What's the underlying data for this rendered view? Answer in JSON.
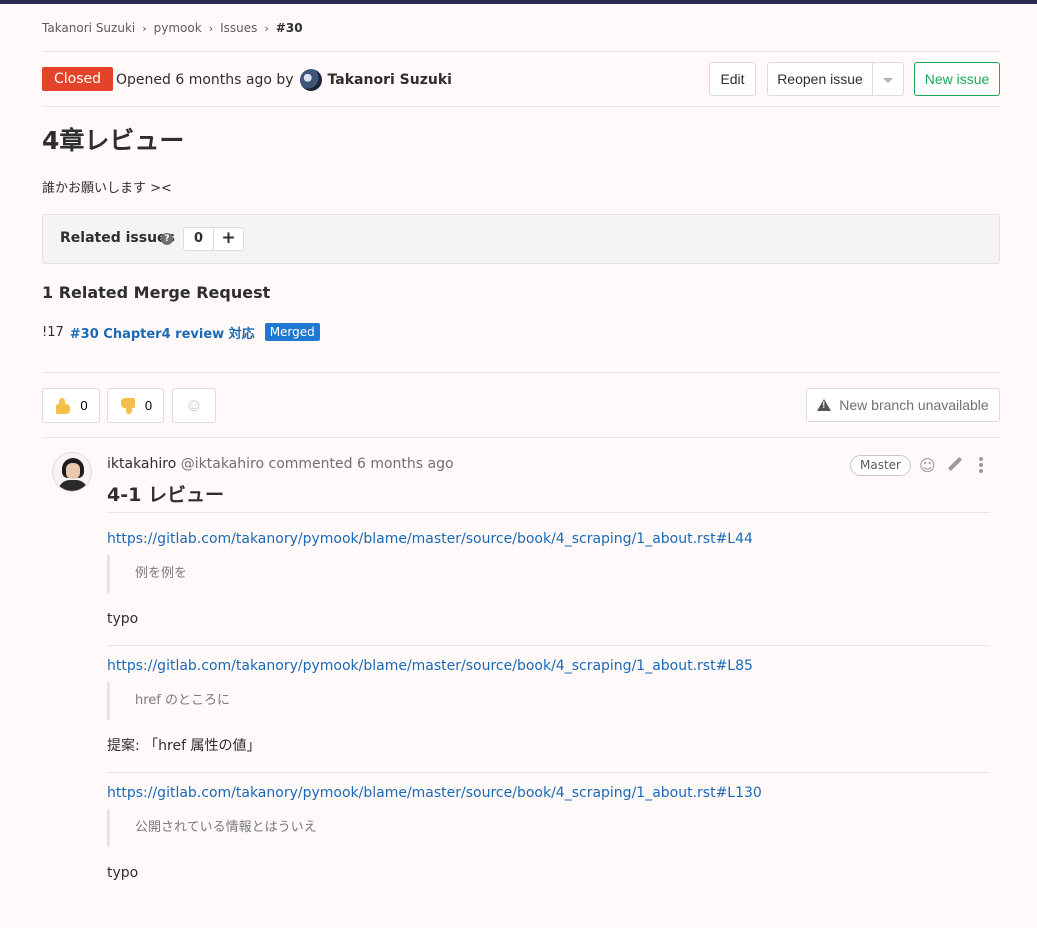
{
  "breadcrumb": {
    "items": [
      "Takanori Suzuki",
      "pymook",
      "Issues"
    ],
    "current": "#30",
    "separator": "›"
  },
  "issue": {
    "status": "Closed",
    "opened_text": "Opened 6 months ago by",
    "author": "Takanori Suzuki",
    "title": "4章レビュー",
    "description": "誰かお願いします ><"
  },
  "actions": {
    "edit_label": "Edit",
    "reopen_label": "Reopen issue",
    "new_issue_label": "New issue"
  },
  "related_issues": {
    "label": "Related issues",
    "help_icon": "question-circle-icon",
    "count": "0",
    "add_icon": "+"
  },
  "related_mr": {
    "heading": "1 Related Merge Request",
    "iid": "!17",
    "title": "#30 Chapter4 review 対応",
    "state": "Merged"
  },
  "awards": {
    "thumbs_up_count": "0",
    "thumbs_down_count": "0",
    "smile_glyph": "☺"
  },
  "branch": {
    "label": "New branch unavailable"
  },
  "comment": {
    "author_name": "iktakahiro",
    "author_handle": "@iktakahiro",
    "meta": "commented 6 months ago",
    "role": "Master",
    "smile_glyph": "☺",
    "title": "4-1 レビュー",
    "blocks": [
      {
        "link": "https://gitlab.com/takanory/pymook/blame/master/source/book/4_scraping/1_about.rst#L44",
        "quote": "例を例を",
        "text": "typo"
      },
      {
        "link": "https://gitlab.com/takanory/pymook/blame/master/source/book/4_scraping/1_about.rst#L85",
        "quote": "href のところに",
        "text": "提案: 「href 属性の値」"
      },
      {
        "link": "https://gitlab.com/takanory/pymook/blame/master/source/book/4_scraping/1_about.rst#L130",
        "quote": "公開されている情報とはういえ",
        "text": "typo"
      }
    ]
  },
  "colors": {
    "closed": "#e24329",
    "merged": "#1f78d1",
    "link": "#1b69b6",
    "new_issue": "#1aaa55"
  }
}
